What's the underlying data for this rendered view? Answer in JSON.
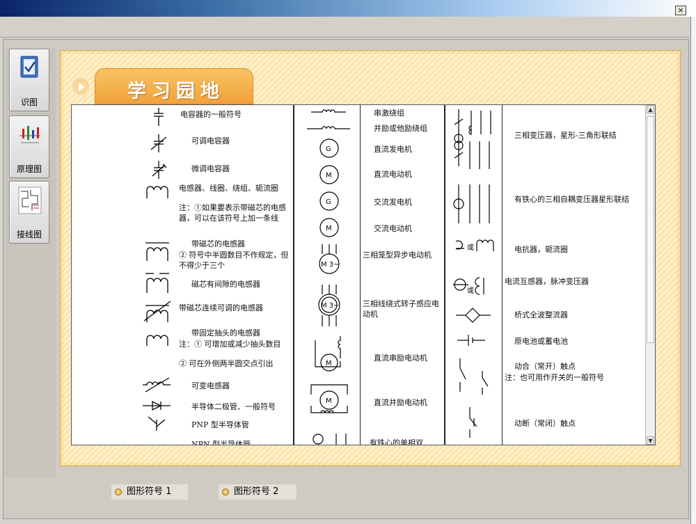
{
  "window": {
    "close_label": "×"
  },
  "sidebar": {
    "items": [
      {
        "label": "识图"
      },
      {
        "label": "原理图"
      },
      {
        "label": "接线图"
      }
    ]
  },
  "section": {
    "title": "学习园地"
  },
  "table": {
    "col1": [
      "电容器的一般符号",
      "可调电容器",
      "微调电容器",
      "电感器、线圈、绕组、轭流圈",
      "注：①如果要表示带磁芯的电感器，可以在该符号上加一条线",
      "带磁芯的电感器",
      "② 符号中半圆数目不作规定，但不得少于三个",
      "磁芯有间隙的电感器",
      "带磁芯连续可调的电感器",
      "带固定抽头的电感器",
      "注：① 可增加或减少抽头数目",
      "② 可在外侧两半圆交点引出",
      "可变电感器",
      "半导体二极管、一般符号",
      "PNP 型半导体管",
      "NPN 型半导体管"
    ],
    "col2": [
      "串激绕组",
      "并励或他励绕组",
      "直流发电机",
      "直流电动机",
      "交流发电机",
      "交流电动机",
      "三相笼型异步电动机",
      "三相线绕式转子感应电动机",
      "直流串励电动机",
      "直流并励电动机",
      "有铁心的单相双"
    ],
    "col3": [
      "三相变压器，星形-三角形联结",
      "有铁心的三相自耦变压器星形联结",
      "电抗器，轭流圈",
      "电流互感器，脉冲变压器",
      "桥式全波整流器",
      "原电池或蓄电池",
      "动合（常开）触点",
      "注：也可用作开关的一般符号",
      "动断（常闭）触点"
    ],
    "symbols": {
      "gen_dc": "G",
      "motor_dc": "M",
      "motor_3ph": "M 3~",
      "or_text": "或"
    }
  },
  "tabs": [
    {
      "label": "图形符号 1"
    },
    {
      "label": "图形符号 2"
    }
  ]
}
